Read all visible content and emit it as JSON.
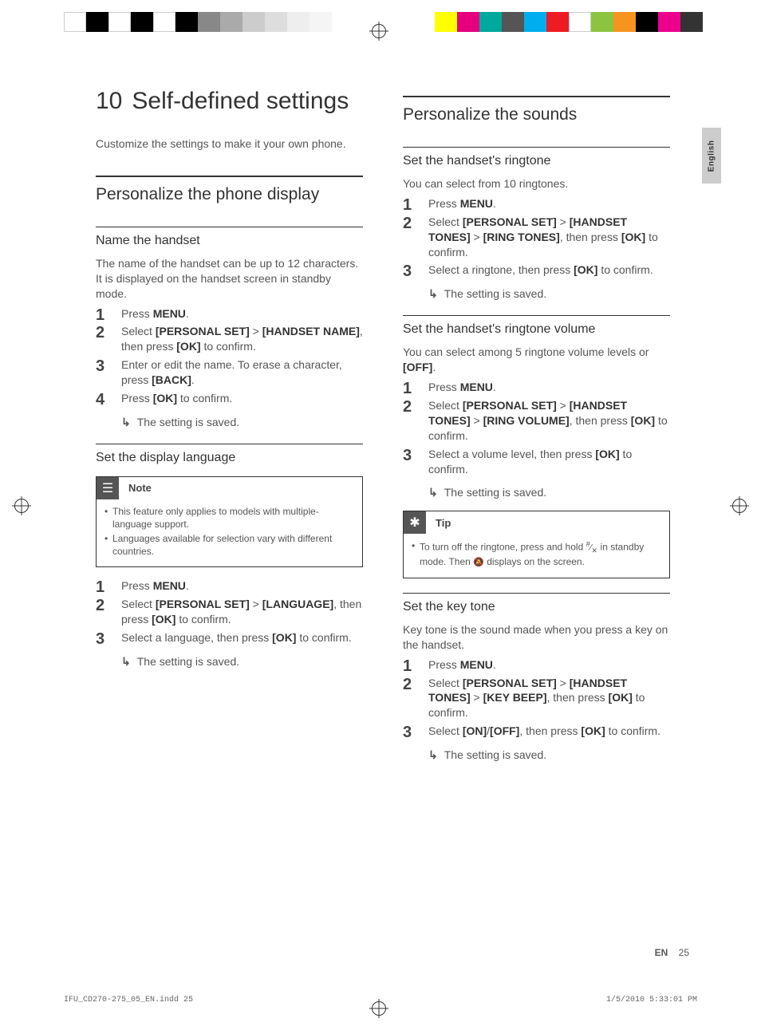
{
  "language_tab": "English",
  "chapter": {
    "number": "10",
    "title": "Self-defined settings"
  },
  "intro": "Customize the settings to make it your own phone.",
  "left": {
    "section": "Personalize the phone display",
    "sub1": {
      "title": "Name the handset",
      "body": "The name of the handset can be up to 12 characters. It is displayed on the handset screen in standby mode.",
      "steps": {
        "s1_a": "Press ",
        "s1_b": "MENU",
        "s1_c": ".",
        "s2_a": "Select ",
        "s2_b": "[PERSONAL SET]",
        "s2_c": " > ",
        "s2_d": "[HANDSET NAME]",
        "s2_e": ", then press ",
        "s2_f": "[OK]",
        "s2_g": " to confirm.",
        "s3_a": "Enter or edit the name. To erase a character, press ",
        "s3_b": "[BACK]",
        "s3_c": ".",
        "s4_a": "Press ",
        "s4_b": "[OK]",
        "s4_c": " to confirm."
      },
      "result": "The setting is saved."
    },
    "sub2": {
      "title": "Set the display language",
      "note": {
        "label": "Note",
        "items": [
          "This feature only applies to models with multiple-language support.",
          "Languages available for selection vary with different countries."
        ]
      },
      "steps": {
        "s1_a": "Press ",
        "s1_b": "MENU",
        "s1_c": ".",
        "s2_a": "Select ",
        "s2_b": "[PERSONAL SET]",
        "s2_c": " > ",
        "s2_d": "[LANGUAGE]",
        "s2_e": ", then press ",
        "s2_f": "[OK]",
        "s2_g": " to confirm.",
        "s3_a": "Select a language, then press ",
        "s3_b": "[OK]",
        "s3_c": " to confirm."
      },
      "result": "The setting is saved."
    }
  },
  "right": {
    "section": "Personalize the sounds",
    "sub1": {
      "title": "Set the handset's ringtone",
      "body": "You can select from 10 ringtones.",
      "steps": {
        "s1_a": "Press ",
        "s1_b": "MENU",
        "s1_c": ".",
        "s2_a": "Select ",
        "s2_b": "[PERSONAL SET]",
        "s2_c": " > ",
        "s2_d": "[HANDSET TONES]",
        "s2_e": " > ",
        "s2_f": "[RING TONES]",
        "s2_g": ", then press ",
        "s2_h": "[OK]",
        "s2_i": " to confirm.",
        "s3_a": "Select a ringtone, then press ",
        "s3_b": "[OK]",
        "s3_c": " to confirm."
      },
      "result": "The setting is saved."
    },
    "sub2": {
      "title": "Set the handset's ringtone volume",
      "body_a": "You can select among 5 ringtone volume levels or ",
      "body_b": "[OFF]",
      "body_c": ".",
      "steps": {
        "s1_a": "Press ",
        "s1_b": "MENU",
        "s1_c": ".",
        "s2_a": "Select ",
        "s2_b": "[PERSONAL SET]",
        "s2_c": " > ",
        "s2_d": "[HANDSET TONES]",
        "s2_e": " > ",
        "s2_f": "[RING VOLUME]",
        "s2_g": ", then press ",
        "s2_h": "[OK]",
        "s2_i": " to confirm.",
        "s3_a": "Select a volume level, then press ",
        "s3_b": "[OK]",
        "s3_c": " to confirm."
      },
      "result": "The setting is saved.",
      "tip": {
        "label": "Tip",
        "text_a": "To turn off the ringtone, press and hold ",
        "text_b": " in standby mode. Then ",
        "text_c": " displays on the screen."
      }
    },
    "sub3": {
      "title": "Set the key tone",
      "body": "Key tone is the sound made when you press a key on the handset.",
      "steps": {
        "s1_a": "Press ",
        "s1_b": "MENU",
        "s1_c": ".",
        "s2_a": "Select ",
        "s2_b": "[PERSONAL SET]",
        "s2_c": " > ",
        "s2_d": "[HANDSET TONES]",
        "s2_e": " > ",
        "s2_f": "[KEY BEEP]",
        "s2_g": ", then press ",
        "s2_h": "[OK]",
        "s2_i": " to confirm.",
        "s3_a": "Select ",
        "s3_b": "[ON]",
        "s3_c": "/",
        "s3_d": "[OFF]",
        "s3_e": ", then press ",
        "s3_f": "[OK]",
        "s3_g": " to confirm."
      },
      "result": "The setting is saved."
    }
  },
  "footer": {
    "lang": "EN",
    "page": "25"
  },
  "print_footer": {
    "left": "IFU_CD270-275_05_EN.indd   25",
    "right": "1/5/2010   5:33:01 PM"
  },
  "colorbar_left": [
    "#fff",
    "#000",
    "#fff",
    "#000",
    "#fff",
    "#000",
    "#888",
    "#aaa",
    "#ccc",
    "#ddd",
    "#eee",
    "#f5f5f5"
  ],
  "colorbar_right": [
    "#ffff00",
    "#e6007e",
    "#00a99d",
    "#555",
    "#00aeef",
    "#ed1c24",
    "#fff",
    "#8bc53f",
    "#f7941e",
    "#000",
    "#ec008c",
    "#333"
  ]
}
